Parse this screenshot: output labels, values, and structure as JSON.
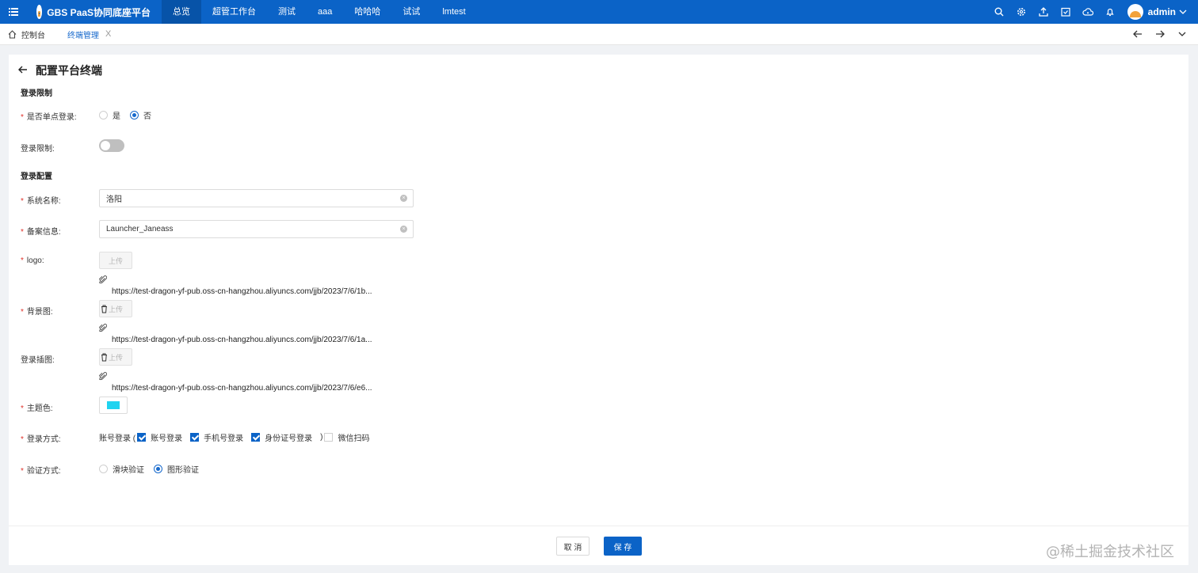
{
  "topbar": {
    "brand": "GBS PaaS协同底座平台",
    "nav": [
      "总览",
      "超管工作台",
      "测试",
      "aaa",
      "哈哈哈",
      "试试",
      "lmtest"
    ],
    "user": "admin"
  },
  "tabs": {
    "home": "控制台",
    "current": "终端管理",
    "close": "X"
  },
  "page": {
    "back": "←",
    "title": "配置平台终端"
  },
  "form": {
    "section_login_limit": "登录限制",
    "sso_label": "是否单点登录:",
    "sso_options": [
      "是",
      "否"
    ],
    "sso_selected": "否",
    "login_limit_label": "登录限制:",
    "login_limit_on": false,
    "section_login_config": "登录配置",
    "system_name_label": "系统名称:",
    "system_name_value": "洛阳",
    "record_label": "备案信息:",
    "record_value": "Launcher_Janeass",
    "logo_label": "logo:",
    "upload_label": "上传",
    "logo_file": "https://test-dragon-yf-pub.oss-cn-hangzhou.aliyuncs.com/jjb/2023/7/6/1b...",
    "bg_label": "背景图:",
    "bg_file": "https://test-dragon-yf-pub.oss-cn-hangzhou.aliyuncs.com/jjb/2023/7/6/1a...",
    "illus_label": "登录插图:",
    "illus_file": "https://test-dragon-yf-pub.oss-cn-hangzhou.aliyuncs.com/jjb/2023/7/6/e6...",
    "theme_label": "主题色:",
    "theme_color": "#1fd3f0",
    "login_method_label": "登录方式:",
    "login_method_prefix": "账号登录 (",
    "login_methods": [
      {
        "label": "账号登录",
        "checked": true
      },
      {
        "label": "手机号登录",
        "checked": true
      },
      {
        "label": "身份证号登录",
        "checked": true
      }
    ],
    "login_method_suffix": ")",
    "wechat_label": "微信扫码",
    "wechat_checked": false,
    "verify_label": "验证方式:",
    "verify_options": [
      "滑块验证",
      "图形验证"
    ],
    "verify_selected": "图形验证"
  },
  "footer": {
    "cancel": "取 消",
    "save": "保 存",
    "watermark": "@稀土掘金技术社区"
  },
  "colors": {
    "primary": "#0b63c7",
    "required": "#e0312a"
  }
}
